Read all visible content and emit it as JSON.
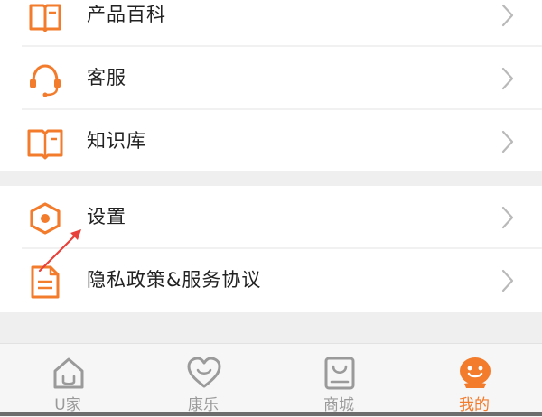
{
  "colors": {
    "accent": "#f37b2c",
    "arrow": "#e8403a",
    "chevron": "#b9b9b9",
    "tab_inactive": "#9a9a9a"
  },
  "menu": {
    "items": [
      {
        "label": "产品百科",
        "icon": "book-icon"
      },
      {
        "label": "客服",
        "icon": "headset-icon"
      },
      {
        "label": "知识库",
        "icon": "open-book-icon"
      },
      {
        "label": "设置",
        "icon": "hexagon-settings-icon"
      },
      {
        "label": "隐私政策&服务协议",
        "icon": "document-icon"
      }
    ]
  },
  "tabs": [
    {
      "label": "U家",
      "icon": "home-icon",
      "active": false
    },
    {
      "label": "康乐",
      "icon": "heart-icon",
      "active": false
    },
    {
      "label": "商城",
      "icon": "shopping-bag-icon",
      "active": false
    },
    {
      "label": "我的",
      "icon": "smiley-face-icon",
      "active": true
    }
  ]
}
